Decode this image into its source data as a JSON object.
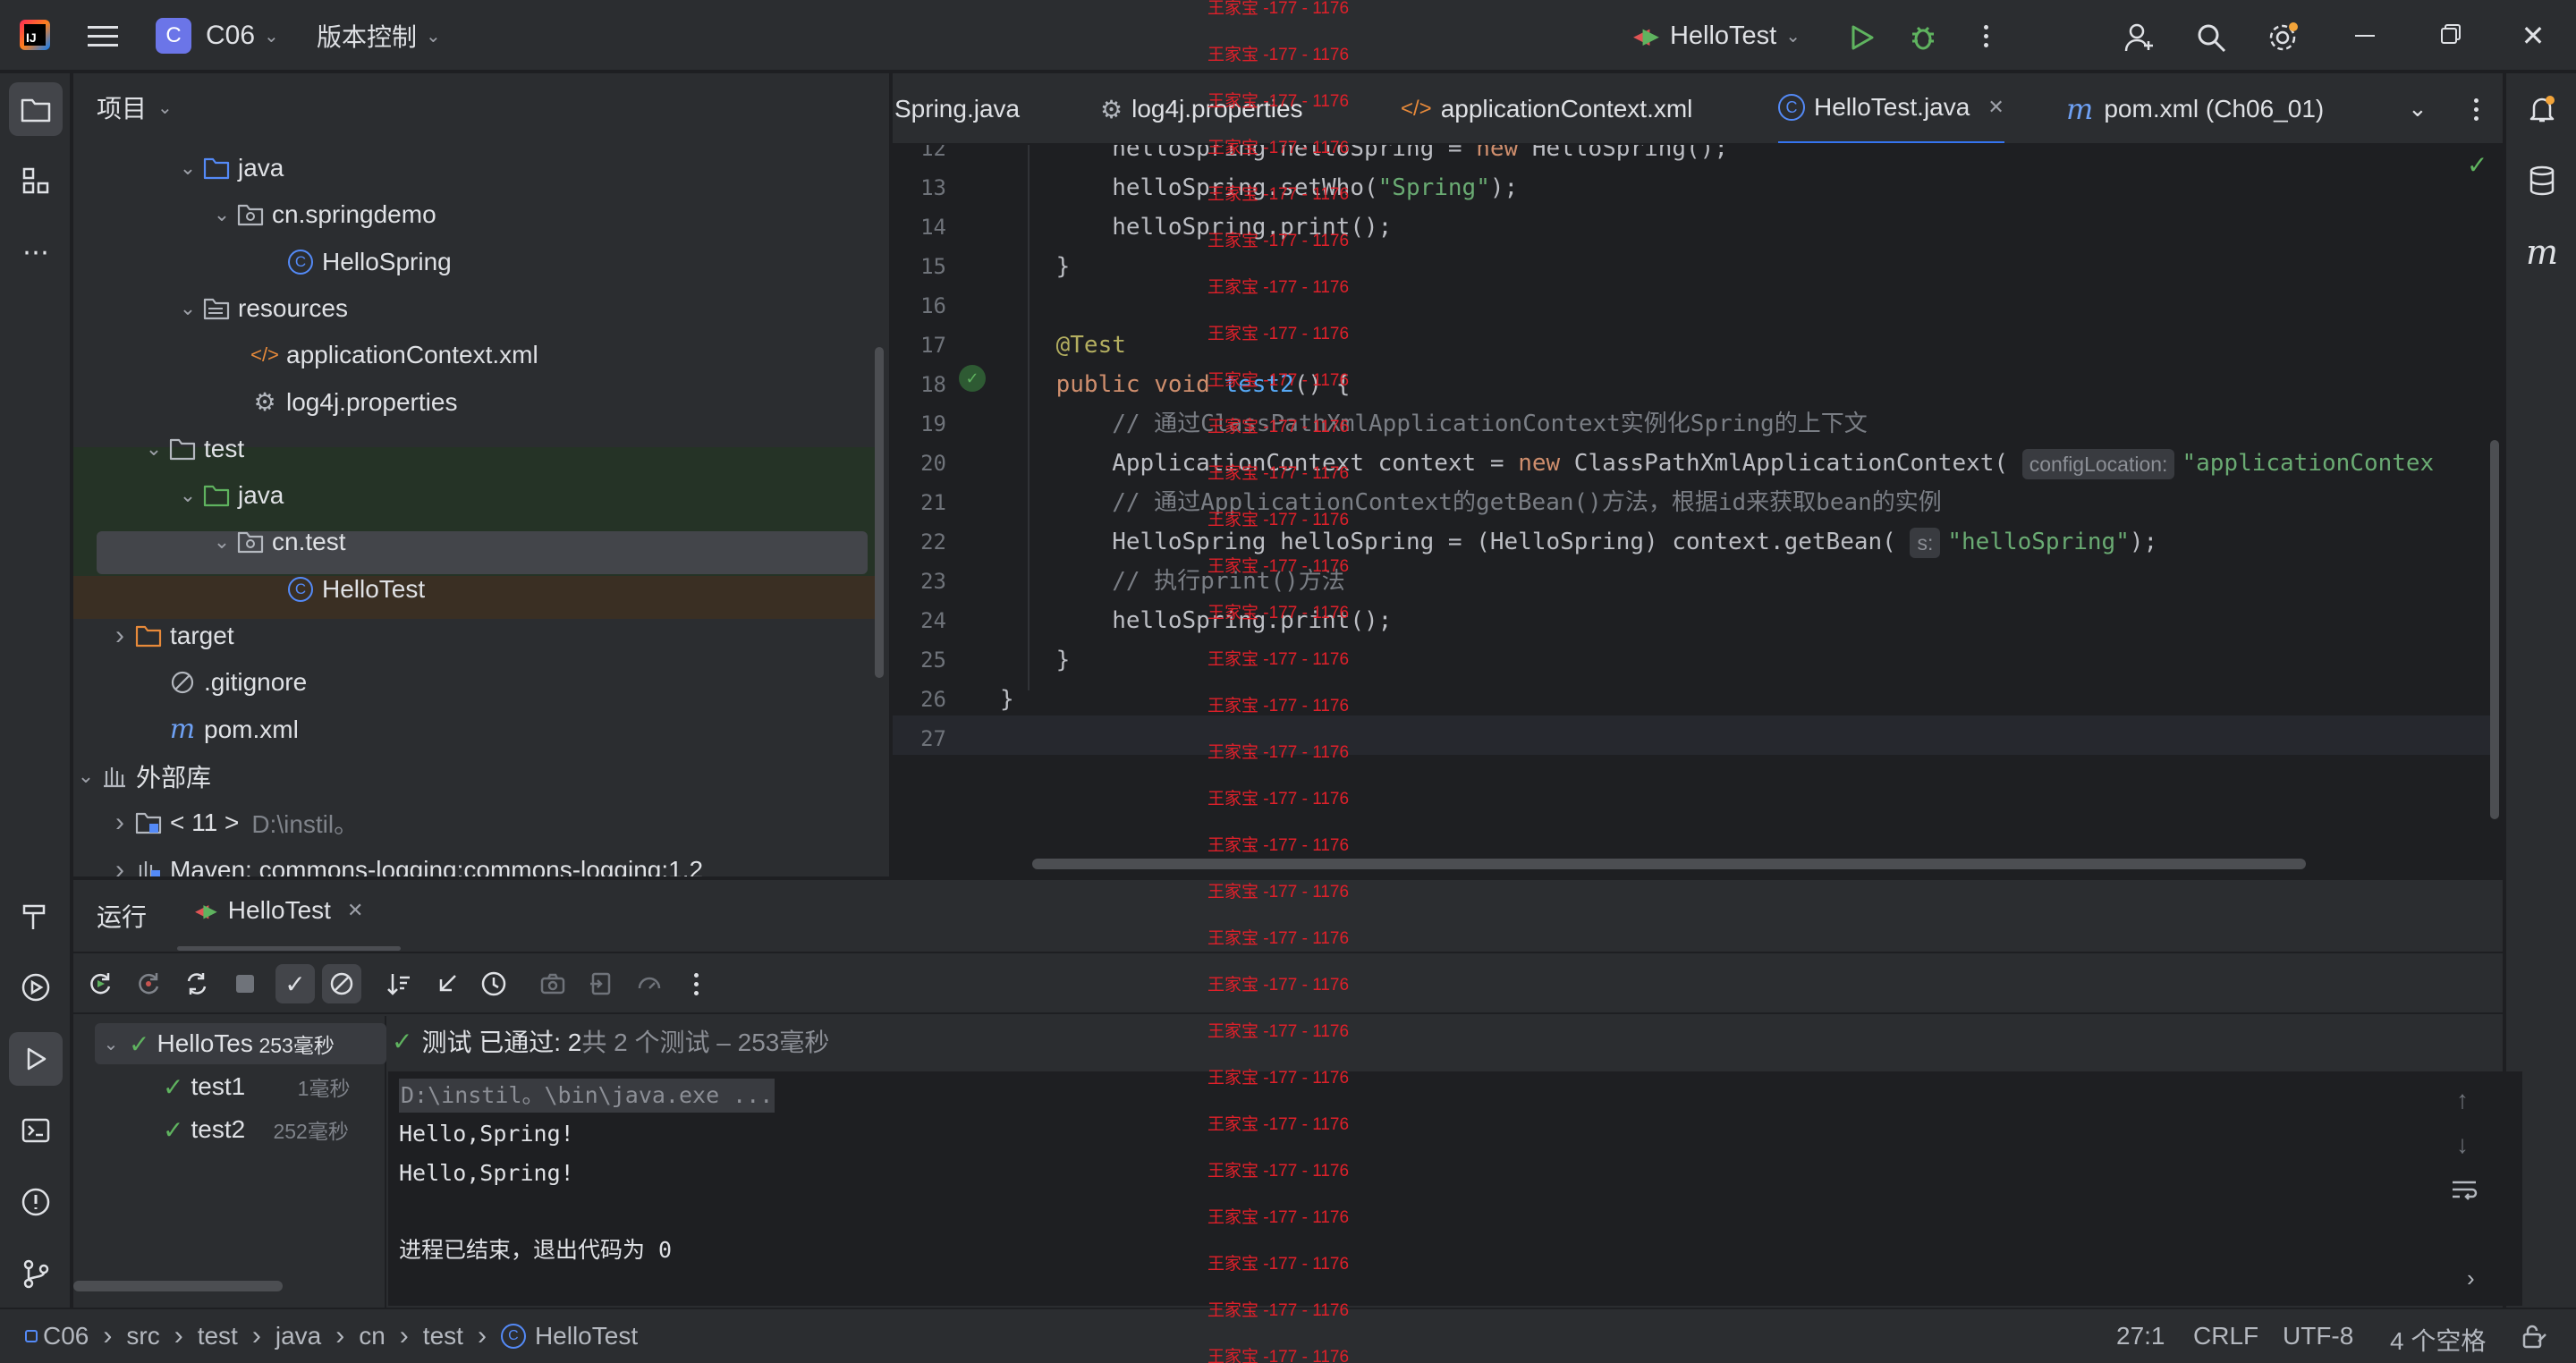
{
  "titlebar": {
    "project_badge": "C",
    "project_name": "C06",
    "vcs_label": "版本控制",
    "run_config": "HelloTest"
  },
  "project_panel": {
    "title": "项目",
    "tree": [
      {
        "label": "java",
        "icon": "folder-source-icon"
      },
      {
        "label": "cn.springdemo",
        "icon": "package-icon"
      },
      {
        "label": "HelloSpring",
        "icon": "class-icon"
      },
      {
        "label": "resources",
        "icon": "folder-resources-icon"
      },
      {
        "label": "applicationContext.xml",
        "icon": "xml-file-icon"
      },
      {
        "label": "log4j.properties",
        "icon": "properties-file-icon"
      },
      {
        "label": "test",
        "icon": "folder-icon"
      },
      {
        "label": "java",
        "icon": "folder-test-icon"
      },
      {
        "label": "cn.test",
        "icon": "package-icon"
      },
      {
        "label": "HelloTest",
        "icon": "class-icon"
      },
      {
        "label": "target",
        "icon": "folder-excluded-icon"
      },
      {
        "label": ".gitignore",
        "icon": "gitignore-icon"
      },
      {
        "label": "pom.xml",
        "icon": "maven-icon"
      },
      {
        "label": "外部库",
        "icon": "library-icon"
      },
      {
        "label": "< 11 >",
        "dim": "D:\\instil。",
        "icon": "jdk-icon"
      },
      {
        "label": "Maven: commons-logging:commons-logging:1.2",
        "icon": "maven-lib-icon"
      },
      {
        "label": "Maven: junit:junit:4.12",
        "icon": "maven-lib-icon"
      }
    ]
  },
  "editor_tabs": [
    {
      "label": "Spring.java"
    },
    {
      "label": "log4j.properties"
    },
    {
      "label": "applicationContext.xml"
    },
    {
      "label": "HelloTest.java"
    },
    {
      "label": "pom.xml (Ch06_01)"
    }
  ],
  "editor": {
    "line_numbers": [
      "12",
      "13",
      "14",
      "15",
      "16",
      "17",
      "18",
      "19",
      "20",
      "21",
      "22",
      "23",
      "24",
      "25",
      "26",
      "27"
    ],
    "lines": [
      {
        "parts": [
          [
            "",
            "        helloSpring helloSpring = "
          ],
          [
            "kw",
            "new"
          ],
          [
            "",
            " HelloSpring();"
          ]
        ]
      },
      {
        "parts": [
          [
            "",
            "        helloSpring.setWho("
          ],
          [
            "str",
            "\"Spring\""
          ],
          [
            "",
            ");"
          ]
        ]
      },
      {
        "parts": [
          [
            "",
            "        helloSpring.print();"
          ]
        ]
      },
      {
        "parts": [
          [
            "",
            "    }"
          ]
        ]
      },
      {
        "parts": [
          [
            "",
            ""
          ]
        ]
      },
      {
        "parts": [
          [
            "ann",
            "    @Test"
          ]
        ]
      },
      {
        "parts": [
          [
            "",
            "    "
          ],
          [
            "kw",
            "public void "
          ],
          [
            "fn",
            "test2"
          ],
          [
            "",
            "() {"
          ]
        ]
      },
      {
        "parts": [
          [
            "cm",
            "        // 通过ClassPathXmlApplicationContext实例化Spring的上下文"
          ]
        ]
      },
      {
        "parts": [
          [
            "",
            "        ApplicationContext context = "
          ],
          [
            "kw",
            "new"
          ],
          [
            "",
            " ClassPathXmlApplicationContext( "
          ],
          [
            "hint",
            "configLocation:"
          ],
          [
            "str",
            "\"applicationContex"
          ]
        ]
      },
      {
        "parts": [
          [
            "cm",
            "        // 通过ApplicationContext的getBean()方法，根据id来获取bean的实例"
          ]
        ]
      },
      {
        "parts": [
          [
            "",
            "        HelloSpring helloSpring = (HelloSpring) context.getBean( "
          ],
          [
            "hint",
            "s:"
          ],
          [
            "str",
            "\"helloSpring\""
          ],
          [
            "",
            ");"
          ]
        ]
      },
      {
        "parts": [
          [
            "cm",
            "        // 执行print()方法"
          ]
        ]
      },
      {
        "parts": [
          [
            "",
            "        helloSpring.print();"
          ]
        ]
      },
      {
        "parts": [
          [
            "",
            "    }"
          ]
        ]
      },
      {
        "parts": [
          [
            "",
            "}"
          ]
        ]
      },
      {
        "parts": [
          [
            "",
            ""
          ]
        ]
      }
    ]
  },
  "run_panel": {
    "tab_run": "运行",
    "tab_test": "HelloTest",
    "tests": [
      {
        "name": "HelloTes",
        "time": "253毫秒"
      },
      {
        "name": "test1",
        "time": "1毫秒"
      },
      {
        "name": "test2",
        "time": "252毫秒"
      }
    ],
    "summary_bold": "测试 已通过: 2",
    "summary_rest": "共 2 个测试 – 253毫秒",
    "console": [
      "D:\\instil。\\bin\\java.exe ...",
      "Hello,Spring!",
      "Hello,Spring!",
      "",
      "进程已结束，退出代码为 0"
    ]
  },
  "statusbar": {
    "crumbs": [
      "C06",
      "src",
      "test",
      "java",
      "cn",
      "test",
      "HelloTest"
    ],
    "position": "27:1",
    "line_sep": "CRLF",
    "encoding": "UTF-8",
    "indent": "4 个空格"
  },
  "watermark": "王家宝 -177 - 1176"
}
